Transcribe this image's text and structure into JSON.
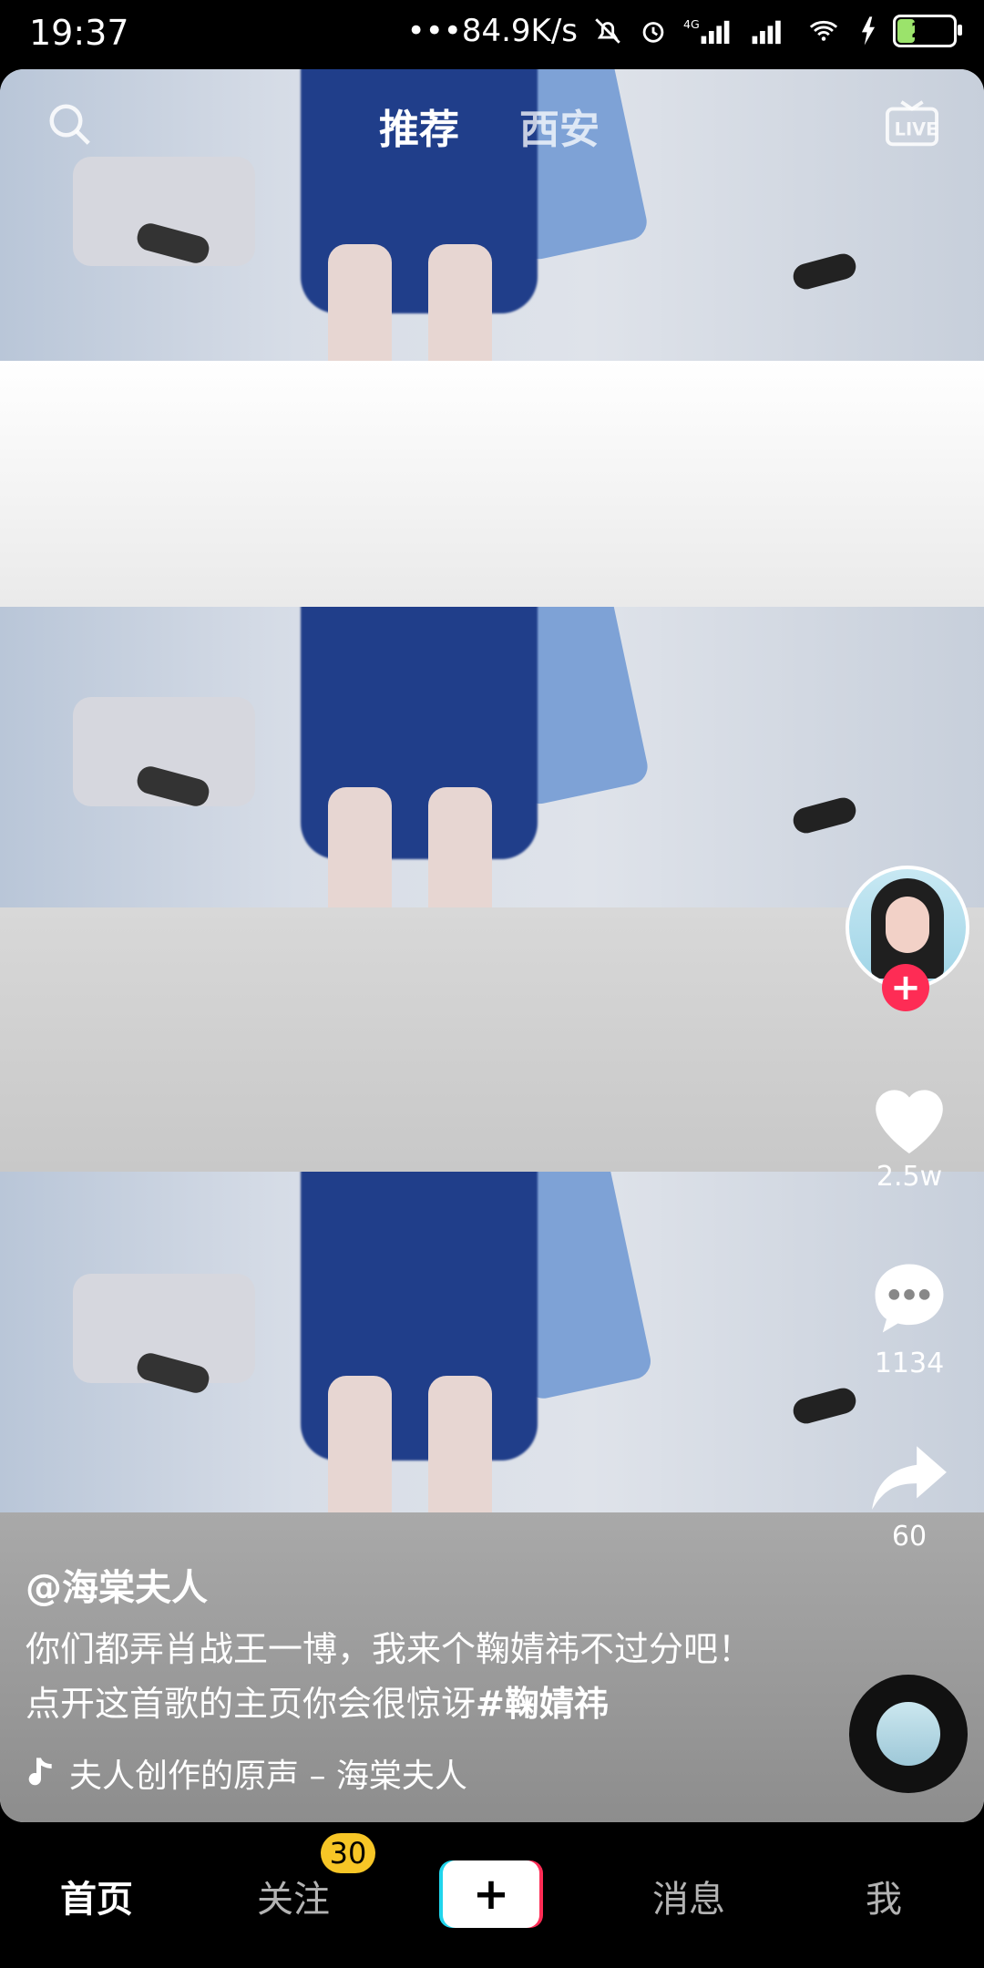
{
  "status_bar": {
    "time": "19:37",
    "net_speed": "•••84.9K/s",
    "battery": "26"
  },
  "top_tabs": {
    "active": "推荐",
    "inactive": "西安"
  },
  "icons": {
    "search": "search-icon",
    "live": "live-icon",
    "like": "heart-icon",
    "comment": "comment-icon",
    "share": "share-icon",
    "music": "music-note-icon"
  },
  "rail": {
    "likes": "2.5w",
    "comments": "1134",
    "shares": "60"
  },
  "video": {
    "author": "@海棠夫人",
    "caption_text": "你们都弄肖战王一博，我来个鞠婧祎不过分吧！点开这首歌的主页你会很惊讶",
    "hashtag": "#鞠婧祎",
    "music": "夫人创作的原声 – 海棠夫人"
  },
  "bottom_nav": {
    "home": "首页",
    "follow": "关注",
    "follow_badge": "30",
    "plus": "+",
    "messages": "消息",
    "me": "我"
  },
  "colors": {
    "accent_red": "#fe2c55",
    "accent_cyan": "#20d5ec",
    "badge_yellow": "#f7c626"
  }
}
